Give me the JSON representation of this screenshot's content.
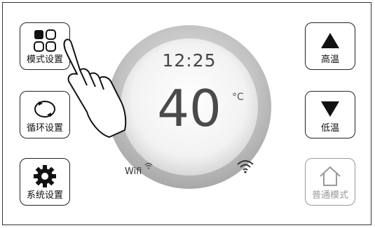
{
  "left_buttons": [
    {
      "label": "模式设置",
      "icon": "grid-icon"
    },
    {
      "label": "循环设置",
      "icon": "cycle-icon"
    },
    {
      "label": "系统设置",
      "icon": "gear-icon"
    }
  ],
  "right_buttons": [
    {
      "label": "高温",
      "icon": "arrow-up-icon"
    },
    {
      "label": "低温",
      "icon": "arrow-down-icon"
    },
    {
      "label": "普通模式",
      "icon": "home-icon",
      "disabled": true
    }
  ],
  "display": {
    "time": "12:25",
    "temperature": "40",
    "unit": "°C",
    "wifi_label": "Wifi"
  },
  "colors": {
    "border": "#222222",
    "disabled": "#999999",
    "dial_outer": "#b8b8b8",
    "dial_inner": "#f4f4f4"
  }
}
